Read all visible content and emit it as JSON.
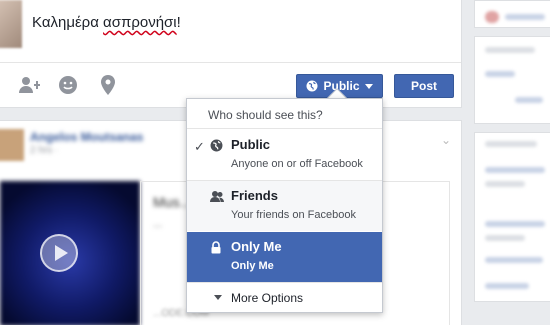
{
  "composer": {
    "text_part1": "Καλημέρα ",
    "text_misspelled": "ασπρονήσι",
    "text_part2": "!",
    "privacy_button_label": "Public",
    "post_button_label": "Post"
  },
  "privacy_menu": {
    "header": "Who should see this?",
    "options": [
      {
        "title": "Public",
        "subtitle": "Anyone on or off Facebook",
        "icon": "globe-icon",
        "checked": true,
        "highlighted": false
      },
      {
        "title": "Friends",
        "subtitle": "Your friends on Facebook",
        "icon": "friends-icon",
        "checked": false,
        "highlighted": false
      },
      {
        "title": "Only Me",
        "subtitle": "Only Me",
        "icon": "lock-icon",
        "checked": false,
        "highlighted": true
      }
    ],
    "more_options_label": "More Options"
  },
  "story": {
    "author": "Angelos Moutsanas",
    "meta": "2 hrs · ",
    "card_title": "Mus...",
    "card_desc": "...",
    "card_domain": "...ODE.COM"
  },
  "colors": {
    "brand_blue": "#4267b2",
    "page_bg": "#e9ebee",
    "link_blue": "#365899"
  }
}
